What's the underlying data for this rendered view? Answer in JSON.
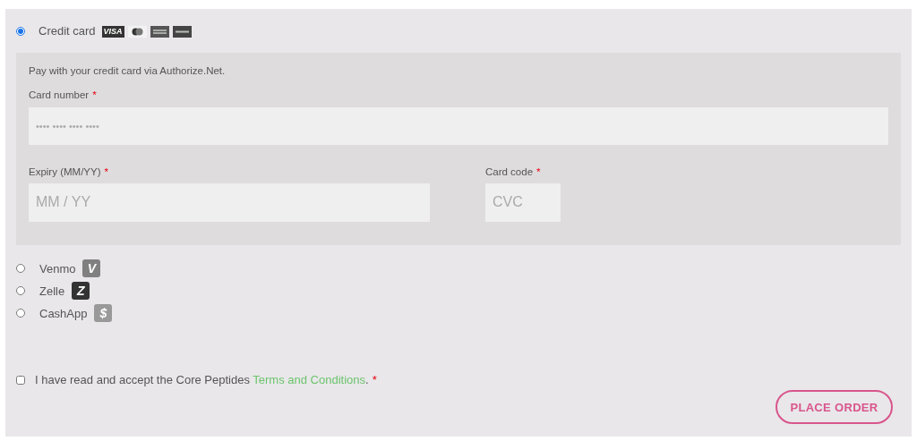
{
  "payment_methods": [
    {
      "label": "Credit card",
      "selected": true,
      "kind": "card",
      "cards": [
        {
          "label": "VISA"
        },
        {
          "kind": "mastercard"
        },
        {
          "kind": "amex"
        },
        {
          "kind": "discover"
        }
      ]
    },
    {
      "label": "Venmo",
      "selected": false,
      "kind": "glyph",
      "glyph": "V",
      "color": "#808080"
    },
    {
      "label": "Zelle",
      "selected": false,
      "kind": "glyph",
      "glyph": "Z",
      "color": "#333333"
    },
    {
      "label": "CashApp",
      "selected": false,
      "kind": "glyph",
      "glyph": "$",
      "color": "#999999"
    }
  ],
  "card_form": {
    "description": "Pay with your credit card via Authorize.Net.",
    "card_number": {
      "label": "Card number",
      "required_mark": "*",
      "placeholder": "•••• •••• •••• ••••"
    },
    "expiry": {
      "label": "Expiry (MM/YY)",
      "required_mark": "*",
      "placeholder": "MM / YY"
    },
    "card_code": {
      "label": "Card code",
      "required_mark": "*",
      "placeholder": "CVC"
    }
  },
  "terms": {
    "checked": false,
    "text": "I have read and accept the Core Peptides",
    "link": "Terms and Conditions",
    "after": ".",
    "required_mark": "*"
  },
  "place_order_button": "PLACE ORDER"
}
